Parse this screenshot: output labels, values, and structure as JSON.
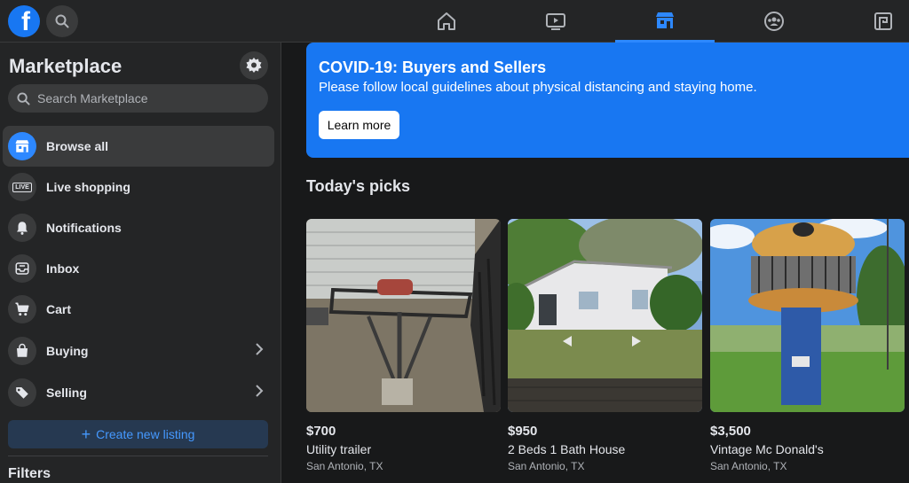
{
  "nav": {
    "tabs": [
      {
        "name": "home"
      },
      {
        "name": "watch"
      },
      {
        "name": "marketplace",
        "active": true
      },
      {
        "name": "groups"
      },
      {
        "name": "gaming"
      }
    ]
  },
  "sidebar": {
    "title": "Marketplace",
    "search_placeholder": "Search Marketplace",
    "items": [
      {
        "label": "Browse all",
        "icon": "storefront-icon",
        "active": true
      },
      {
        "label": "Live shopping",
        "icon": "live-icon"
      },
      {
        "label": "Notifications",
        "icon": "bell-icon"
      },
      {
        "label": "Inbox",
        "icon": "inbox-icon"
      },
      {
        "label": "Cart",
        "icon": "cart-icon"
      },
      {
        "label": "Buying",
        "icon": "shopping-bag-icon"
      },
      {
        "label": "Selling",
        "icon": "tag-icon"
      }
    ],
    "live_badge": "LIVE",
    "create_label": "Create new listing",
    "filters_label": "Filters"
  },
  "banner": {
    "title": "COVID-19: Buyers and Sellers",
    "text": "Please follow local guidelines about physical distancing and staying home.",
    "button_label": "Learn more"
  },
  "main": {
    "section_title": "Today's picks",
    "listings": [
      {
        "price": "$700",
        "title": "Utility trailer",
        "location": "San Antonio, TX"
      },
      {
        "price": "$950",
        "title": "2 Beds 1 Bath House",
        "location": "San Antonio, TX"
      },
      {
        "price": "$3,500",
        "title": "Vintage Mc Donald's",
        "location": "San Antonio, TX"
      }
    ]
  },
  "colors": {
    "brand": "#1877f2",
    "accent": "#2d88ff",
    "background": "#18191a",
    "surface": "#242526"
  }
}
